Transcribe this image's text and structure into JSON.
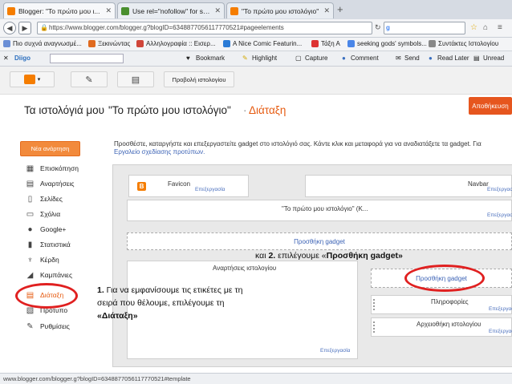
{
  "browser": {
    "tabs": [
      {
        "title": "Blogger: \"Το πρώτο μου ι...",
        "fav_color": "#f57d00"
      },
      {
        "title": "Use rel=\"nofollow\" for spe...",
        "fav_color": "#4a8f2e"
      },
      {
        "title": "\"Το πρώτο μου ιστολόγιο\"",
        "fav_color": "#f57d00"
      }
    ],
    "new_tab": "+",
    "url": "https://www.blogger.com/blogger.g?blogID=6348877056117770521#pageelements",
    "bookmarks": [
      {
        "label": "Πιο συχνά αναγνωσμέ...",
        "color": "#6b8fd6"
      },
      {
        "label": "Ξεκινώντας",
        "color": "#e06a1f"
      },
      {
        "label": "Αλληλογραφία :: Εισερ...",
        "color": "#d0463a"
      },
      {
        "label": "A Nice Comic Featurin...",
        "color": "#2b7bd6"
      },
      {
        "label": "Τάξη Α",
        "color": "#d33"
      },
      {
        "label": "seeking gods' symbols...",
        "color": "#4a86e8"
      },
      {
        "label": "Συντάκτες Ιστολογίου",
        "color": "#888"
      }
    ],
    "toolbar": {
      "diigo": "Diigo",
      "bookmark": "Bookmark",
      "highlight": "Highlight",
      "capture": "Capture",
      "comment": "Comment",
      "send": "Send",
      "read_later": "Read Later",
      "unread": "Unread"
    },
    "status_url": "www.blogger.com/blogger.g?blogID=6348877056117770521#template"
  },
  "blogger": {
    "view_blog_label": "Προβολή ιστολογίου",
    "my_blogs": "Τα ιστολόγιά μου",
    "blog_title": "\"Το πρώτο μου ιστολόγιο\"",
    "separator": "·",
    "section_title": "Διάταξη",
    "view_blog_button": "Αποθήκευση",
    "new_post": "Νέα ανάρτηση",
    "sidebar": [
      {
        "label": "Επισκόπηση",
        "icon": "▦"
      },
      {
        "label": "Αναρτήσεις",
        "icon": "▤"
      },
      {
        "label": "Σελίδες",
        "icon": "▯"
      },
      {
        "label": "Σχόλια",
        "icon": "▭"
      },
      {
        "label": "Google+",
        "icon": "●"
      },
      {
        "label": "Στατιστικά",
        "icon": "▮"
      },
      {
        "label": "Κέρδη",
        "icon": "♆"
      },
      {
        "label": "Καμπάνιες",
        "icon": "◢"
      },
      {
        "label": "Διάταξη",
        "icon": "▤"
      },
      {
        "label": "Πρότυπο",
        "icon": "▧"
      },
      {
        "label": "Ρυθμίσεις",
        "icon": "✎"
      }
    ],
    "desc_line1": "Προσθέστε, καταργήστε και επεξεργαστείτε gadget στο ιστολόγιό σας. Κάντε κλικ και μεταφορά για να αναδιατάξετε τα gadget. Για",
    "desc_line2": "Εργαλείο σχεδίασης προτύπων.",
    "gadgets": {
      "favicon": "Favicon",
      "navbar": "Navbar",
      "header": "\"Το πρώτο μου ιστολόγιο\" (K...",
      "add_gadget": "Προσθήκη gadget",
      "posts": "Αναρτήσεις ιστολογίου",
      "add_gadget_sidebar": "Προσθήκη gadget",
      "info": "Πληροφορίες",
      "archive": "Αρχειοθήκη ιστολογίου",
      "edit": "Επεξεργασία"
    },
    "callout2_prefix": "και ",
    "callout2_num": "2.",
    "callout2_text": " επιλέγουμε «",
    "callout2_bold": "Προσθήκη gadget»",
    "callout1_num": "1.",
    "callout1_text": " Για να εμφανίσουμε τις ετικέτες με τη σειρά που θέλουμε, επιλέγουμε τη",
    "callout1_bold": "«Διάταξη»",
    "accent_color": "#e65b11",
    "highlight_color": "#e02020"
  }
}
